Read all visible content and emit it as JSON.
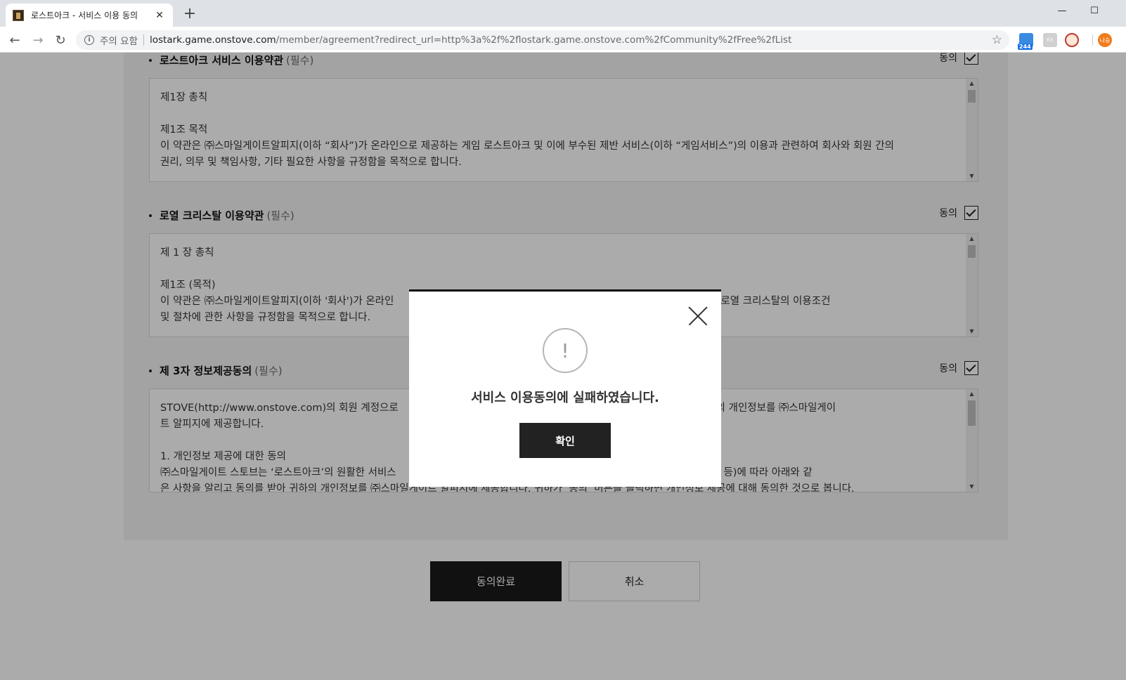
{
  "browser": {
    "tab_title": "로스트아크 - 서비스 이용 동의",
    "tab_close": "✕",
    "new_tab": "+",
    "security_label": "주의 요함",
    "url_host": "lostark.game.onstove.com",
    "url_path": "/member/agreement?redirect_url=http%3a%2f%2flostark.game.onstove.com%2fCommunity%2fFree%2fList",
    "extension_badge": "244",
    "extension_2": "EX",
    "profile_label": "나승"
  },
  "sections": [
    {
      "title": "로스트아크 서비스 이용약관",
      "required": "(필수)",
      "agree_label": "동의",
      "lines": [
        "제1장 총칙",
        "",
        "제1조 목적",
        "이 약관은 ㈜스마일게이트알피지(이하 “회사”)가 온라인으로 제공하는 게임 로스트아크 및 이에 부수된 제반 서비스(이하 “게임서비스”)의 이용과 관련하여 회사와 회원 간의",
        "권리, 의무 및 책임사항, 기타 필요한 사항을 규정함을 목적으로 합니다."
      ]
    },
    {
      "title": "로열 크리스탈 이용약관",
      "required": "(필수)",
      "agree_label": "동의",
      "lines": [
        "제 1 장 총칙",
        "",
        "제1조 (목적)",
        "이 약관은 ㈜스마일게이트알피지(이하 '회사')가 온라인                                                                      임서비스”)에 사용되는 로열 크리스탈의 이용조건",
        "및 절차에 관한 사항을 규정함을 목적으로 합니다."
      ]
    },
    {
      "title": "제 3자 정보제공동의",
      "required": "(필수)",
      "agree_label": "동의",
      "lines": [
        "STOVE(http://www.onstove.com)의 회원 계정으로                                                                      토브는 필요한 최소한의 개인정보를 ㈜스마일게이",
        "트 알피지에 제공합니다.",
        "",
        "1. 개인정보 제공에 대한 동의",
        "㈜스마일게이트 스토브는 ‘로스트아크’의 원활한 서비스                                                            4조의 2(개인정보의 제공 동의 등)에 따라 아래와 같",
        "은 사항을 알리고 동의를 받아 귀하의 개인정보를 ㈜스마일게이트 알피지에 제공합니다. 귀하가 ‘동의’ 버튼을 클릭하면 개인정보 제공에 대해 동의한 것으로 봅니다."
      ]
    }
  ],
  "buttons": {
    "confirm": "동의완료",
    "cancel": "취소"
  },
  "modal": {
    "icon": "!",
    "message": "서비스 이용동의에 실패하였습니다.",
    "ok": "확인"
  }
}
